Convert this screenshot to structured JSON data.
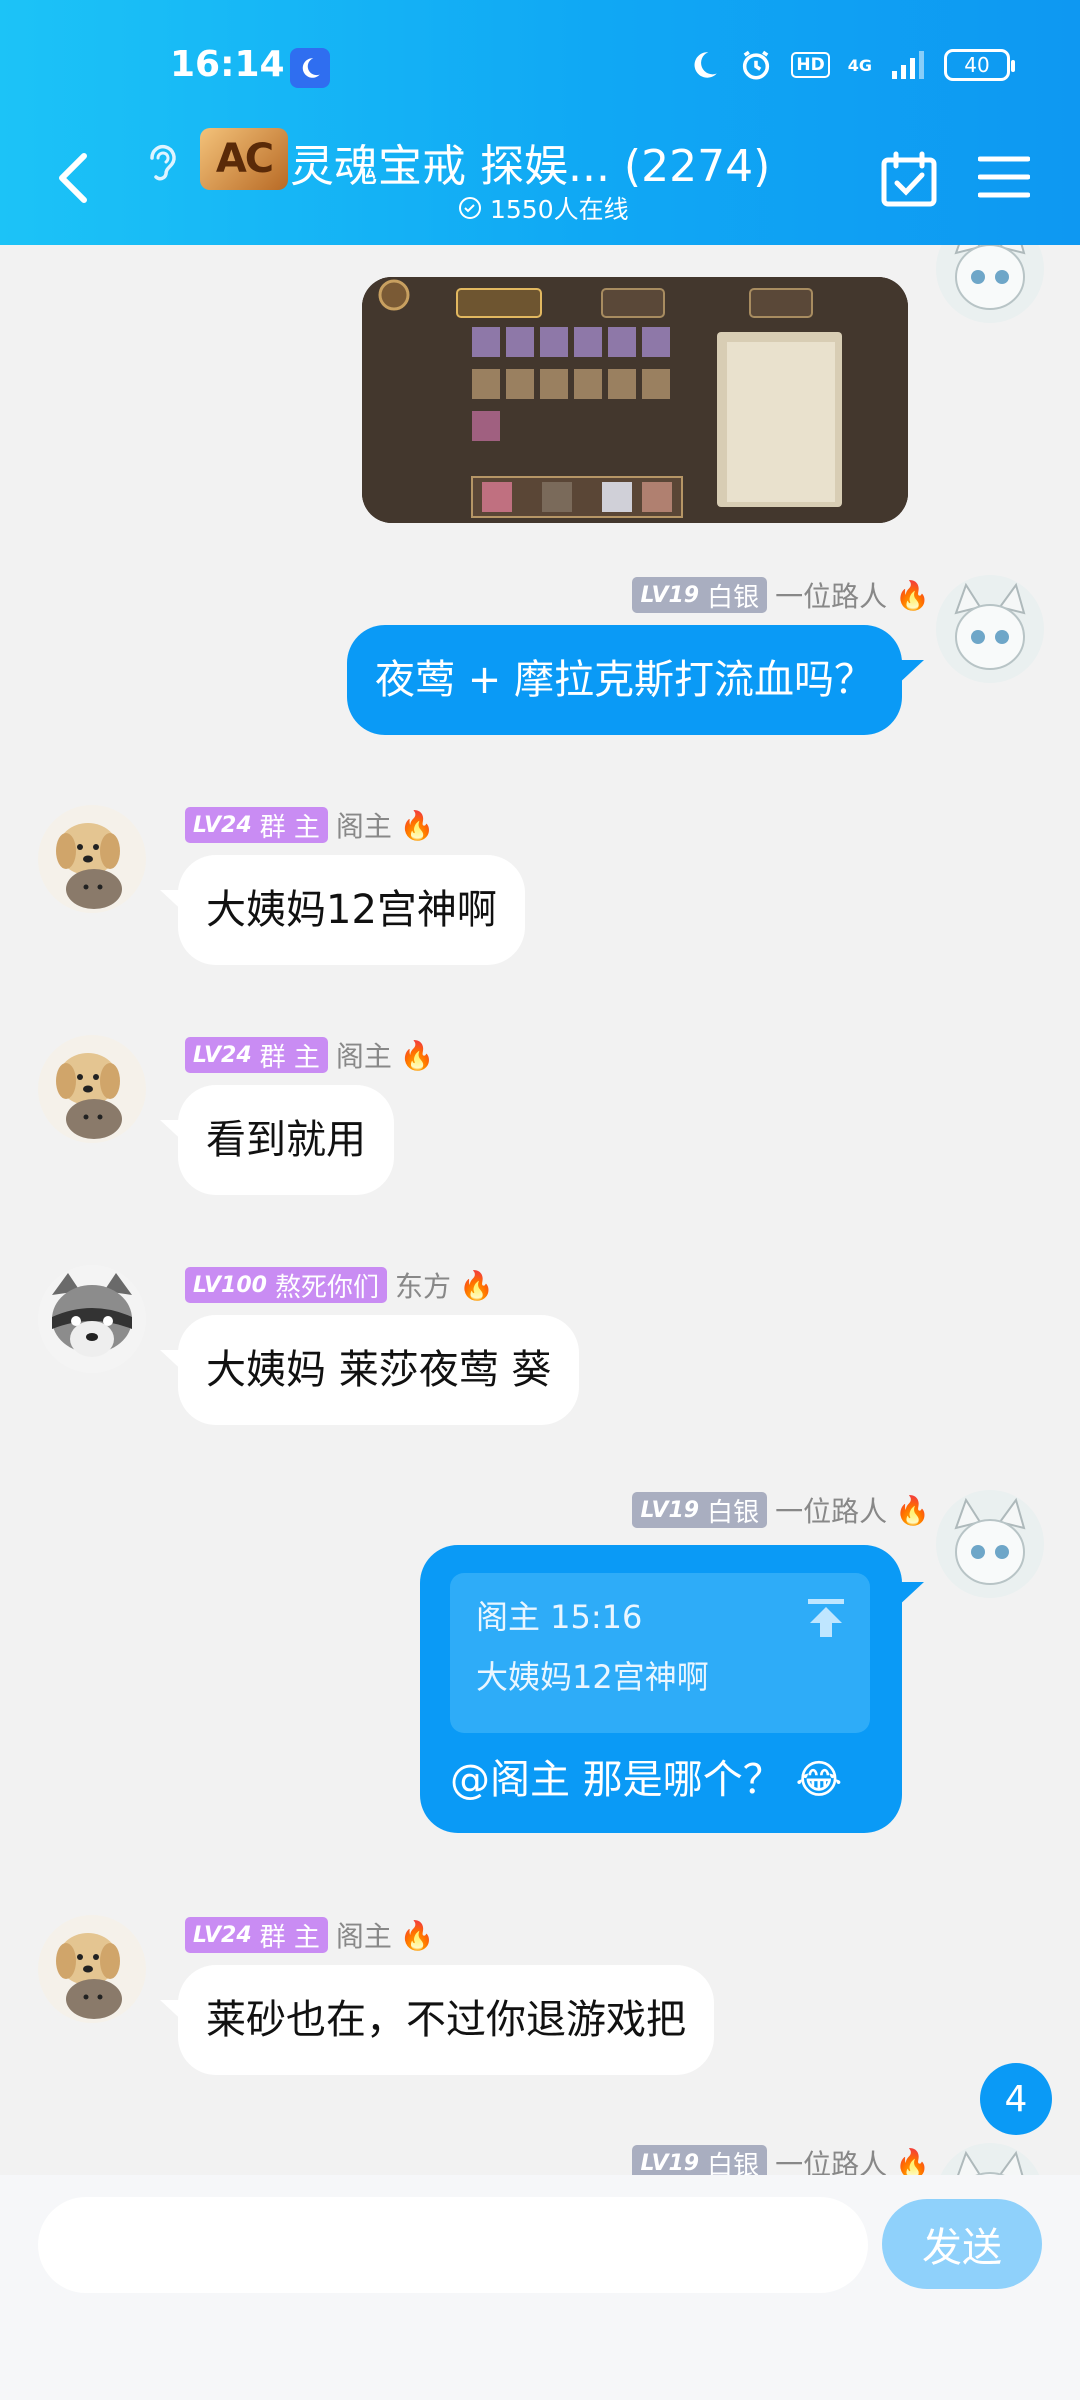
{
  "status_bar": {
    "time": "16:14",
    "hd": "HD",
    "network": "4G",
    "battery": "40"
  },
  "header": {
    "logo_text": "AC",
    "title": "灵魂宝戒 探娱...  (2274)",
    "online": "1550人在线"
  },
  "messages": [
    {
      "sender_level": "LV19",
      "sender_rank": "白银",
      "sender_name": "一位路人",
      "text": "夜莺 + 摩拉克斯打流血吗？"
    },
    {
      "sender_level": "LV24",
      "sender_rank": "群 主",
      "sender_name": "阁主",
      "text": "大姨妈12宫神啊"
    },
    {
      "sender_level": "LV24",
      "sender_rank": "群 主",
      "sender_name": "阁主",
      "text": "看到就用"
    },
    {
      "sender_level": "LV100",
      "sender_rank": "熬死你们",
      "sender_name": "东方",
      "text": "大姨妈 莱莎夜莺 葵"
    },
    {
      "sender_level": "LV19",
      "sender_rank": "白银",
      "sender_name": "一位路人",
      "reply_author": "阁主 15:16",
      "reply_text": "大姨妈12宫神啊",
      "text": "@阁主 那是哪个？",
      "emoji": "😂"
    },
    {
      "sender_level": "LV24",
      "sender_rank": "群 主",
      "sender_name": "阁主",
      "text": "莱砂也在，不过你退游戏把"
    },
    {
      "sender_level": "LV19",
      "sender_rank": "白银",
      "sender_name": "一位路人"
    }
  ],
  "unread_count": "4",
  "input": {
    "value": "",
    "send_label": "发送"
  },
  "toolbar": [
    "microphone-icon",
    "screen-cast-icon",
    "photo-icon",
    "red-packet-icon",
    "emoji-icon",
    "plus-icon"
  ]
}
